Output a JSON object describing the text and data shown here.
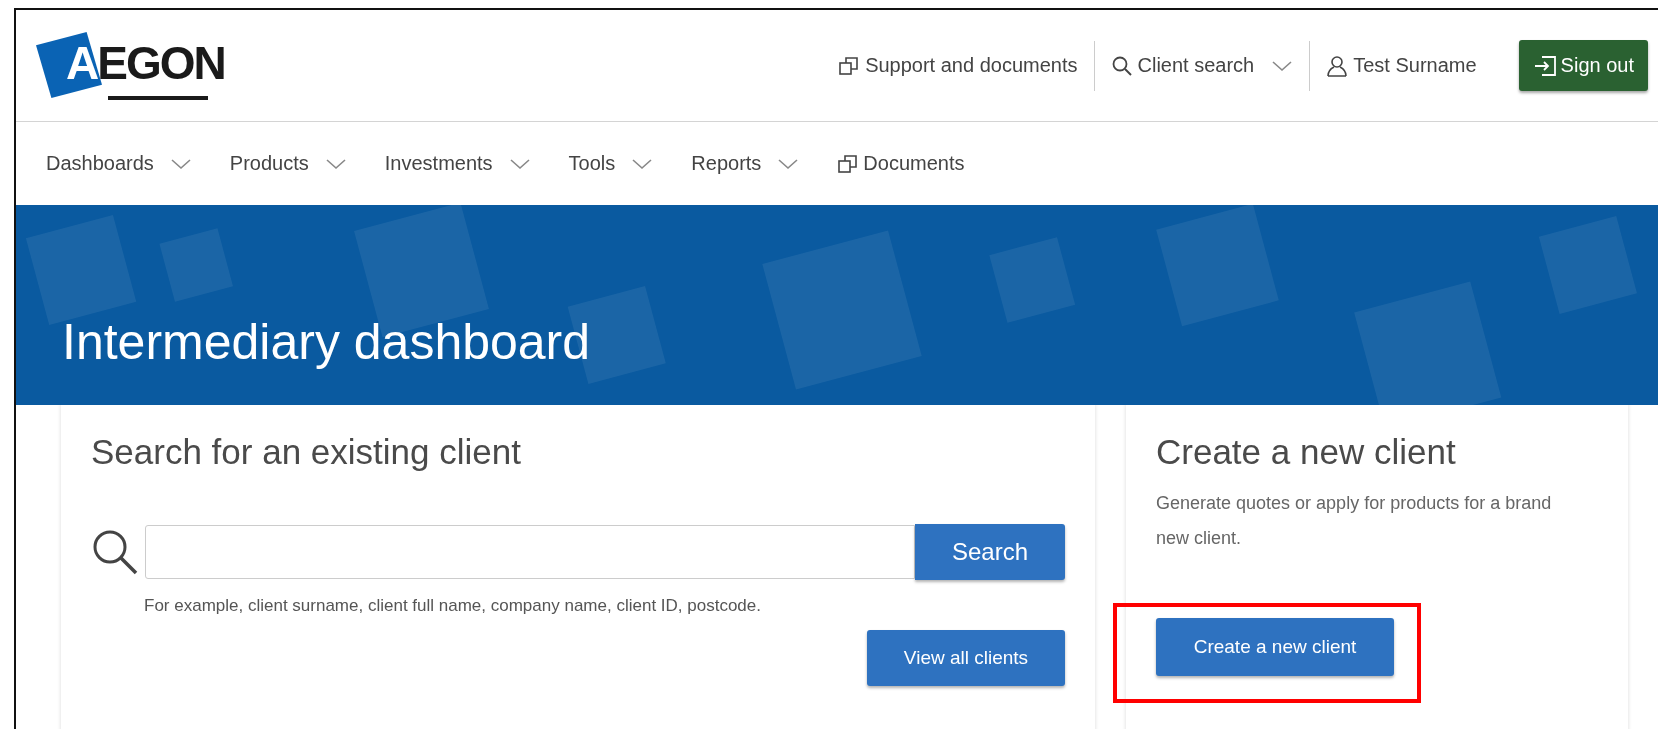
{
  "logo": {
    "text": "AEGON"
  },
  "top_links": [
    {
      "kind": "link",
      "label": "Support and documents"
    },
    {
      "kind": "dropdown",
      "label": "Client search"
    },
    {
      "kind": "user",
      "label": "Test Surname"
    }
  ],
  "sign_out": {
    "label": "Sign out"
  },
  "nav": [
    {
      "label": "Dashboards",
      "dropdown": true
    },
    {
      "label": "Products",
      "dropdown": true
    },
    {
      "label": "Investments",
      "dropdown": true
    },
    {
      "label": "Tools",
      "dropdown": true
    },
    {
      "label": "Reports",
      "dropdown": true
    },
    {
      "label": "Documents",
      "dropdown": false
    }
  ],
  "banner": {
    "title": "Intermediary dashboard"
  },
  "search_card": {
    "title": "Search for an existing client",
    "button": "Search",
    "hint": "For example, client surname, client full name, company name, client ID, postcode.",
    "view_all": "View all clients"
  },
  "create_card": {
    "title": "Create a new client",
    "description": "Generate quotes or apply for products for a brand new client.",
    "button": "Create a new client",
    "highlighted": true
  }
}
